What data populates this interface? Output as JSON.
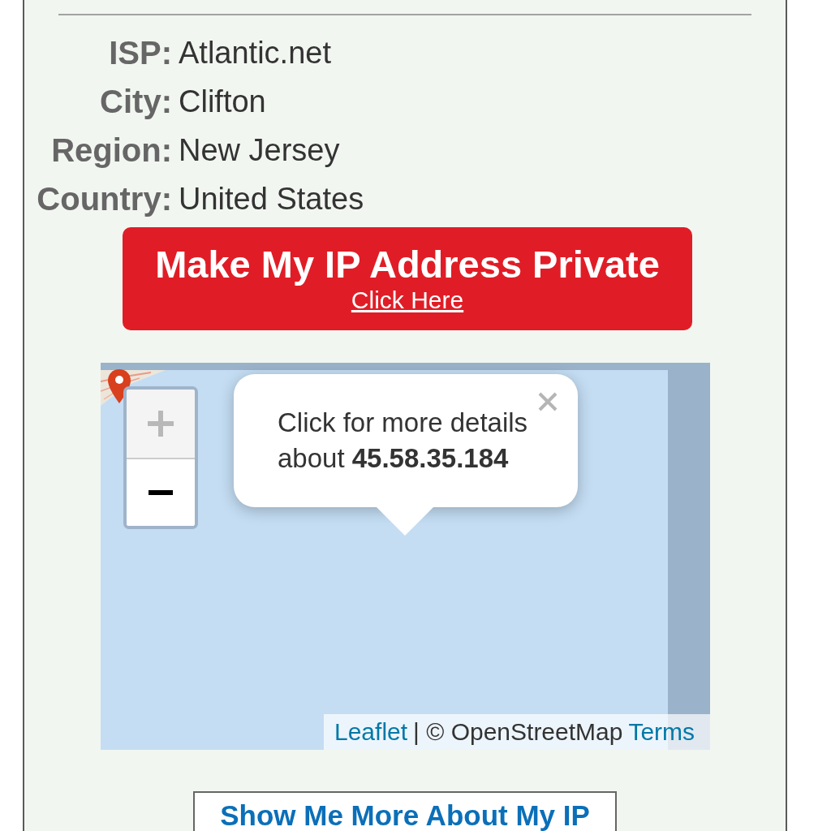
{
  "info_rows": [
    {
      "label": "ISP:",
      "value": "Atlantic.net"
    },
    {
      "label": "City:",
      "value": "Clifton"
    },
    {
      "label": "Region:",
      "value": "New Jersey"
    },
    {
      "label": "Country:",
      "value": "United States"
    }
  ],
  "cta_button": {
    "title": "Make My IP Address Private",
    "link": "Click Here"
  },
  "map": {
    "zoom_control": [
      {
        "kind": "zoom-in",
        "disabled": true
      },
      {
        "kind": "zoom-out",
        "disabled": false
      }
    ],
    "popup": {
      "text": "Click for more details about **45.58.35.184**"
    },
    "attribution": [
      {
        "kind": "link",
        "text": "Leaflet"
      },
      {
        "kind": "text",
        "text": "| © OpenStreetMap"
      },
      {
        "kind": "link",
        "text": "Terms"
      }
    ]
  },
  "more_button": {
    "label": "Show Me More About My IP"
  }
}
